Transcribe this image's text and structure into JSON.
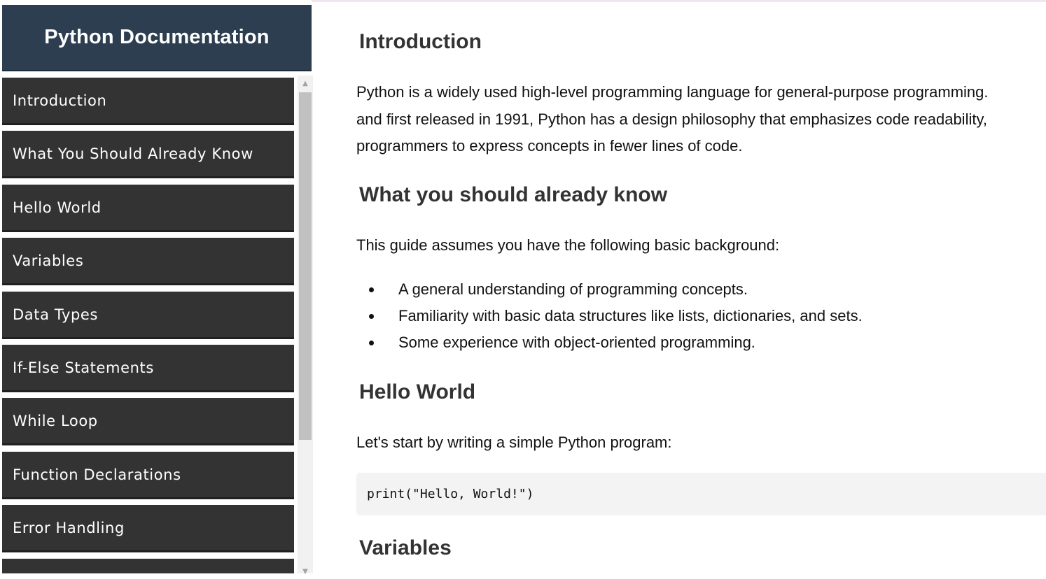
{
  "sidebar": {
    "title": "Python Documentation",
    "items": [
      {
        "label": "Introduction"
      },
      {
        "label": "What You Should Already Know"
      },
      {
        "label": "Hello World"
      },
      {
        "label": "Variables"
      },
      {
        "label": "Data Types"
      },
      {
        "label": "If-Else Statements"
      },
      {
        "label": "While Loop"
      },
      {
        "label": "Function Declarations"
      },
      {
        "label": "Error Handling"
      },
      {
        "label": ""
      }
    ],
    "scroll_up_icon": "▲",
    "scroll_down_icon": "▼"
  },
  "content": {
    "intro": {
      "heading": "Introduction",
      "line1": "Python is a widely used high-level programming language for general-purpose programming.",
      "line2": "and first released in 1991, Python has a design philosophy that emphasizes code readability,",
      "line3": "programmers to express concepts in fewer lines of code."
    },
    "know": {
      "heading": "What you should already know",
      "text": "This guide assumes you have the following basic background:",
      "bullets": [
        "A general understanding of programming concepts.",
        "Familiarity with basic data structures like lists, dictionaries, and sets.",
        "Some experience with object-oriented programming."
      ]
    },
    "hello": {
      "heading": "Hello World",
      "text": "Let's start by writing a simple Python program:",
      "code": "print(\"Hello, World!\")"
    },
    "variables": {
      "heading": "Variables"
    }
  },
  "colors": {
    "header_bg": "#2c3e50",
    "nav_bg": "#333333",
    "code_bg": "#f3f3f3"
  }
}
